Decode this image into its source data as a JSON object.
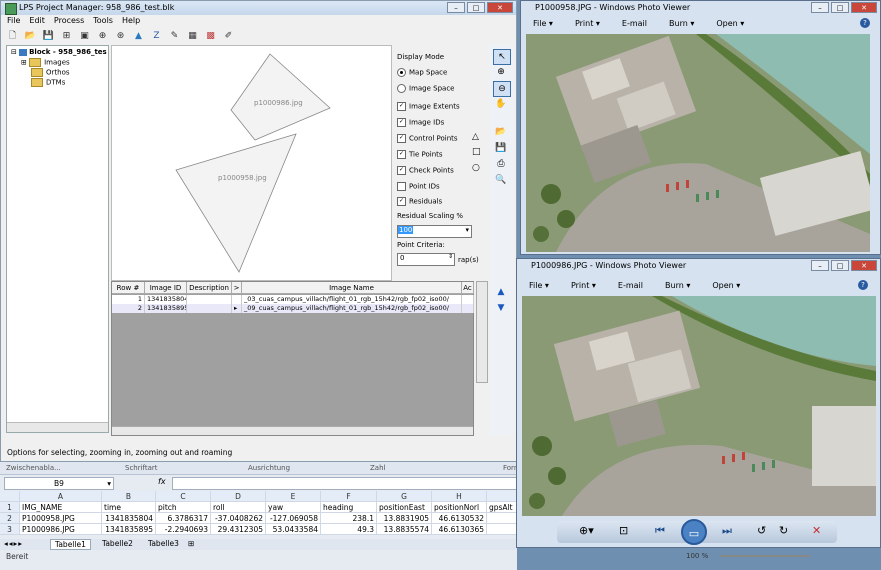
{
  "lps": {
    "title": "LPS Project Manager: 958_986_test.blk",
    "menu": [
      "File",
      "Edit",
      "Process",
      "Tools",
      "Help"
    ],
    "tree": {
      "root": "Block - 958_986_tes",
      "children": [
        "Images",
        "Orthos",
        "DTMs"
      ]
    },
    "map": {
      "labels": [
        "p1000986.jpg",
        "p1000958.jpg"
      ]
    },
    "display": {
      "mode_label": "Display Mode",
      "map_space": "Map Space",
      "image_space": "Image Space",
      "checkboxes": [
        {
          "label": "Image Extents",
          "checked": "✓"
        },
        {
          "label": "Image IDs",
          "checked": "✓"
        },
        {
          "label": "Control Points",
          "checked": "✓"
        },
        {
          "label": "Tie Points",
          "checked": "✓"
        },
        {
          "label": "Check Points",
          "checked": "✓"
        },
        {
          "label": "Point IDs",
          "checked": ""
        },
        {
          "label": "Residuals",
          "checked": "✓"
        }
      ],
      "residual_label": "Residual Scaling %",
      "residual_value": "100",
      "point_criteria_label": "Point Criteria:",
      "point_criteria_value": "0",
      "point_unit": "rap(s)"
    },
    "grid": {
      "headers": [
        "Row #",
        "Image ID",
        "Description",
        ">",
        "Image Name",
        "Ac"
      ],
      "rows": [
        {
          "row": "1",
          "id": "1341835804",
          "desc": "",
          "name": "_03_cuas_campus_villach/flight_01_rgb_15h42/rgb_fp02_iso00/"
        },
        {
          "row": "2",
          "id": "1341835895",
          "desc": "",
          "name": "_09_cuas_campus_villach/flight_01_rgb_15h42/rgb_fp02_iso00/"
        }
      ]
    },
    "status": "Options for selecting, zooming in, zooming out and roaming"
  },
  "excel": {
    "top_groups": [
      "Zwischenabla...",
      "Schriftart",
      "Ausrichtung",
      "Zahl",
      "Forr"
    ],
    "namebox": "B9",
    "fx": "fx",
    "columns": [
      "A",
      "B",
      "C",
      "D",
      "E",
      "F",
      "G",
      "H"
    ],
    "rows": [
      [
        "IMG_NAME",
        "time",
        "pitch",
        "roll",
        "yaw",
        "heading",
        "positionEast",
        "positionNorl",
        "gpsAlt"
      ],
      [
        "P1000958.JPG",
        "1341835804",
        "6.3786317",
        "-37.0408262",
        "-127.069058",
        "238.1",
        "13.8831905",
        "46.6130532",
        ""
      ],
      [
        "P1000986.JPG",
        "1341835895",
        "-2.2940693",
        "29.4312305",
        "53.0433584",
        "49.3",
        "13.8835574",
        "46.6130365",
        ""
      ]
    ],
    "row_numbers": [
      "1",
      "2",
      "3"
    ],
    "sheets": [
      "Tabelle1",
      "Tabelle2",
      "Tabelle3"
    ],
    "status": "Bereit",
    "zoom": "100 %"
  },
  "viewer1": {
    "title": "P1000958.JPG - Windows Photo Viewer",
    "menu": [
      "File",
      "Print",
      "E-mail",
      "Burn",
      "Open"
    ]
  },
  "viewer2": {
    "title": "P1000986.JPG - Windows Photo Viewer",
    "menu": [
      "File",
      "Print",
      "E-mail",
      "Burn",
      "Open"
    ]
  },
  "colors": {
    "accent": "#3a6ea5",
    "selection": "#3399ff",
    "viewer_bg": "#d6e2f0"
  }
}
